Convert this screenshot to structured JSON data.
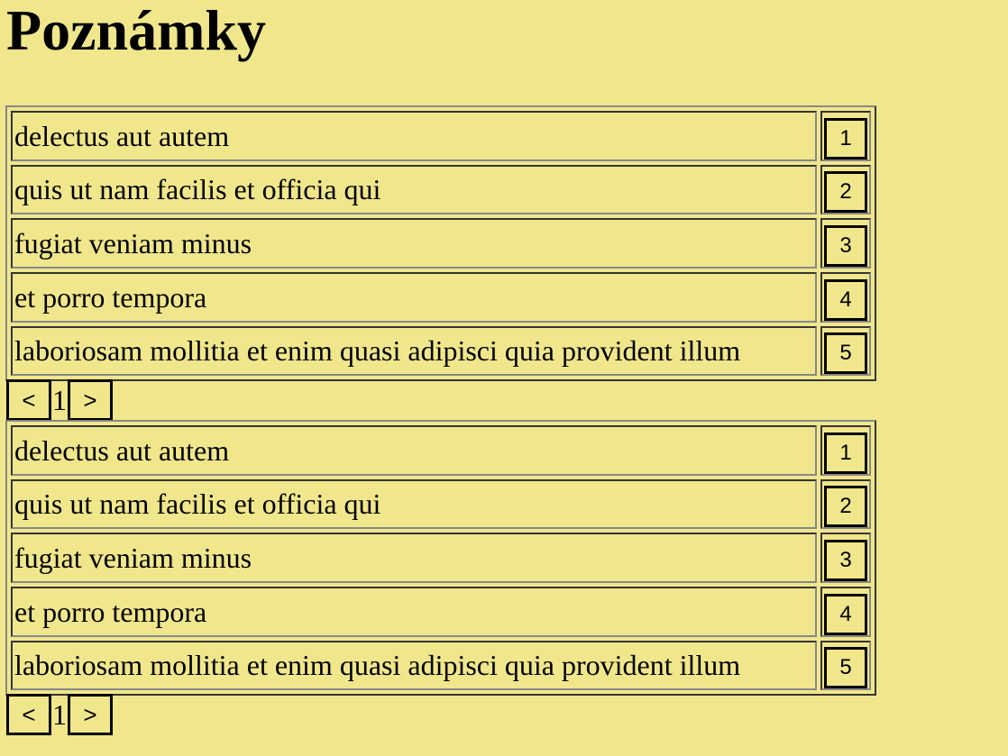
{
  "page": {
    "title": "Poznámky"
  },
  "lists": [
    {
      "rows": [
        {
          "title": "delectus aut autem",
          "num": "1"
        },
        {
          "title": "quis ut nam facilis et officia qui",
          "num": "2"
        },
        {
          "title": "fugiat veniam minus",
          "num": "3"
        },
        {
          "title": "et porro tempora",
          "num": "4"
        },
        {
          "title": "laboriosam mollitia et enim quasi adipisci quia provident illum",
          "num": "5"
        }
      ],
      "pager": {
        "prev_label": "<",
        "page": "1",
        "next_label": ">"
      }
    },
    {
      "rows": [
        {
          "title": "delectus aut autem",
          "num": "1"
        },
        {
          "title": "quis ut nam facilis et officia qui",
          "num": "2"
        },
        {
          "title": "fugiat veniam minus",
          "num": "3"
        },
        {
          "title": "et porro tempora",
          "num": "4"
        },
        {
          "title": "laboriosam mollitia et enim quasi adipisci quia provident illum",
          "num": "5"
        }
      ],
      "pager": {
        "prev_label": "<",
        "page": "1",
        "next_label": ">"
      }
    }
  ],
  "colors": {
    "background": "#f0e68c",
    "border": "#000000"
  }
}
